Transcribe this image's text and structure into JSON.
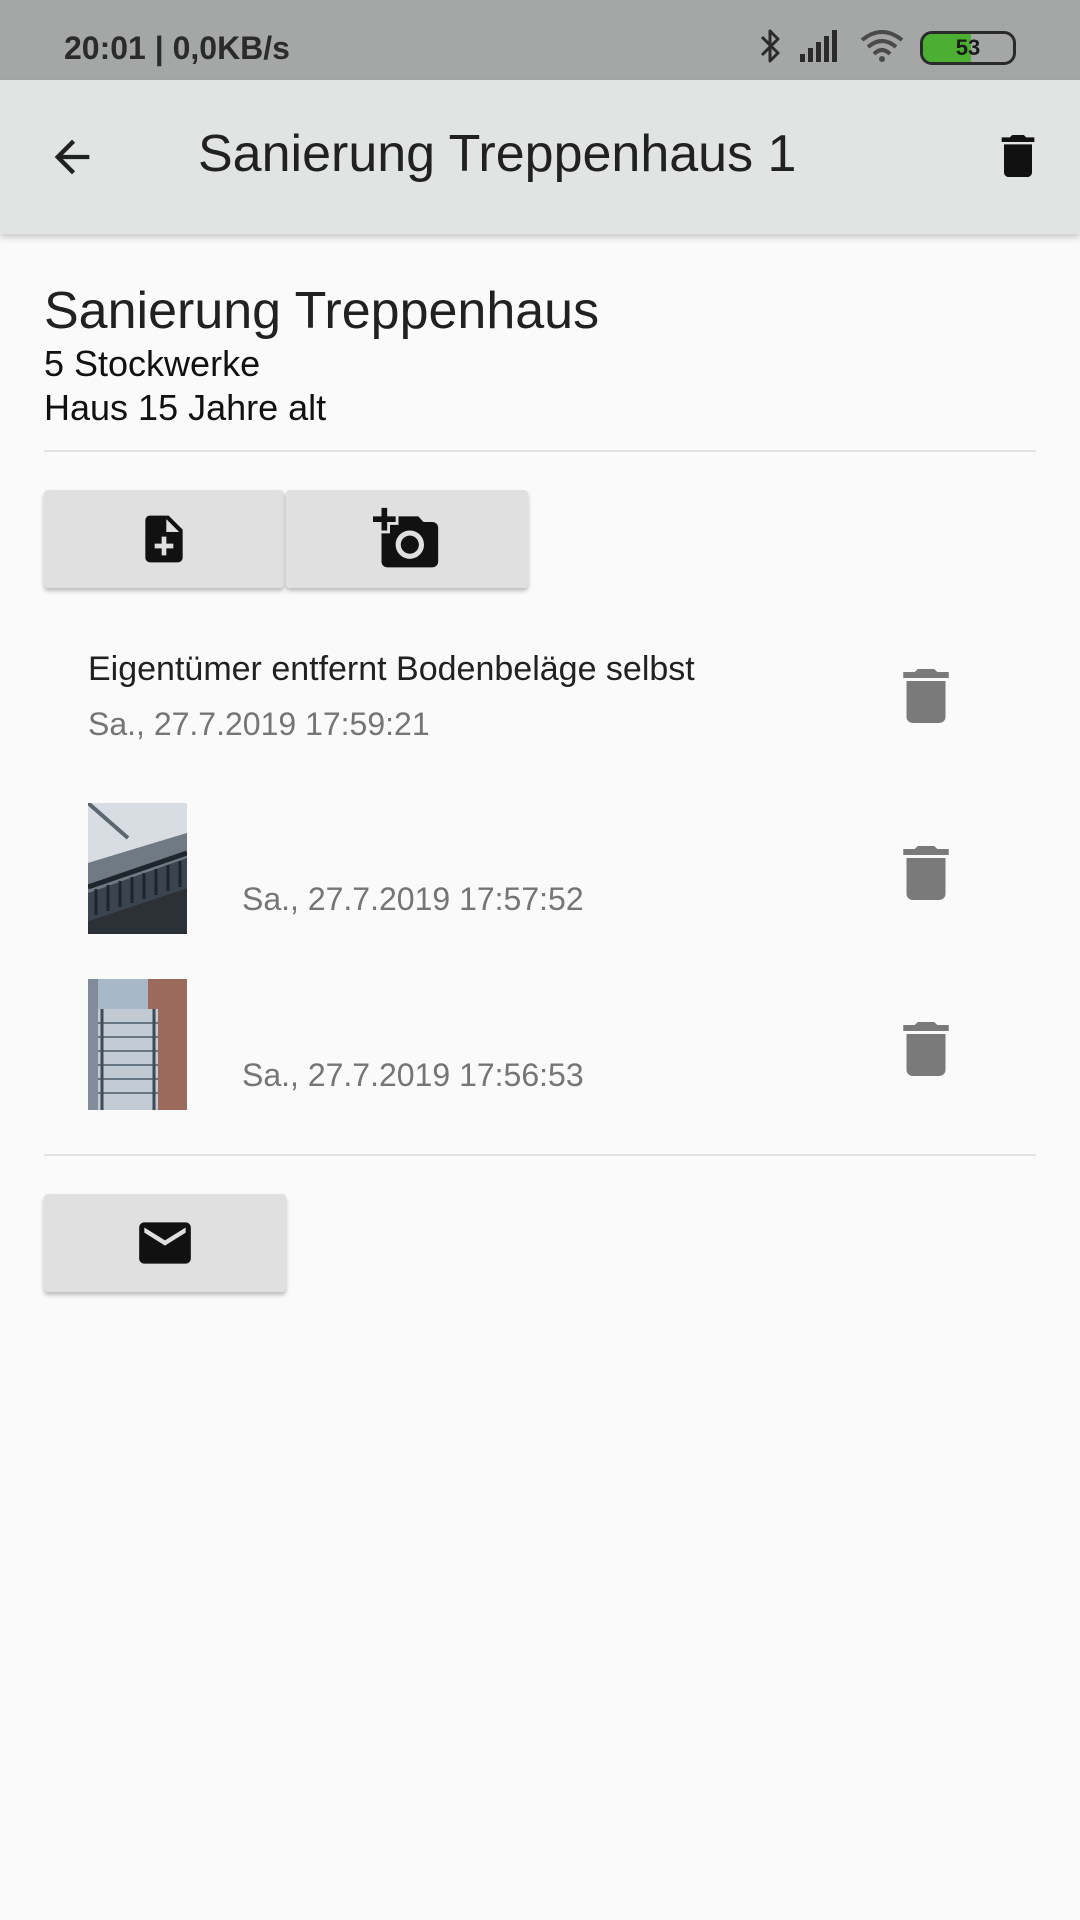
{
  "status_bar": {
    "time": "20:01 | 0,0KB/s",
    "battery": 53,
    "icons": [
      "bluetooth-icon",
      "signal-icon",
      "wifi-icon",
      "battery-icon"
    ]
  },
  "app_bar": {
    "title": "Sanierung Treppenhaus 1",
    "back_icon": "arrow-back-icon",
    "delete_icon": "delete-icon"
  },
  "project": {
    "title": "Sanierung Treppenhaus",
    "lines": [
      "5 Stockwerke",
      "Haus 15 Jahre alt"
    ]
  },
  "actions": {
    "add_note_icon": "note-add-icon",
    "add_photo_icon": "add-a-photo-icon",
    "email_icon": "email-icon"
  },
  "entries": [
    {
      "type": "note",
      "text": "Eigentümer entfernt Bodenbeläge selbst",
      "date": "Sa., 27.7.2019 17:59:21"
    },
    {
      "type": "photo",
      "date": "Sa., 27.7.2019 17:57:52"
    },
    {
      "type": "photo",
      "date": "Sa., 27.7.2019 17:56:53"
    }
  ],
  "colors": {
    "status_bar": "#a5a7a6",
    "app_bar": "#e1e4e3",
    "button": "#e0e0e0",
    "battery_fill": "#4caf32",
    "icon_grey": "#7a7a7a"
  }
}
